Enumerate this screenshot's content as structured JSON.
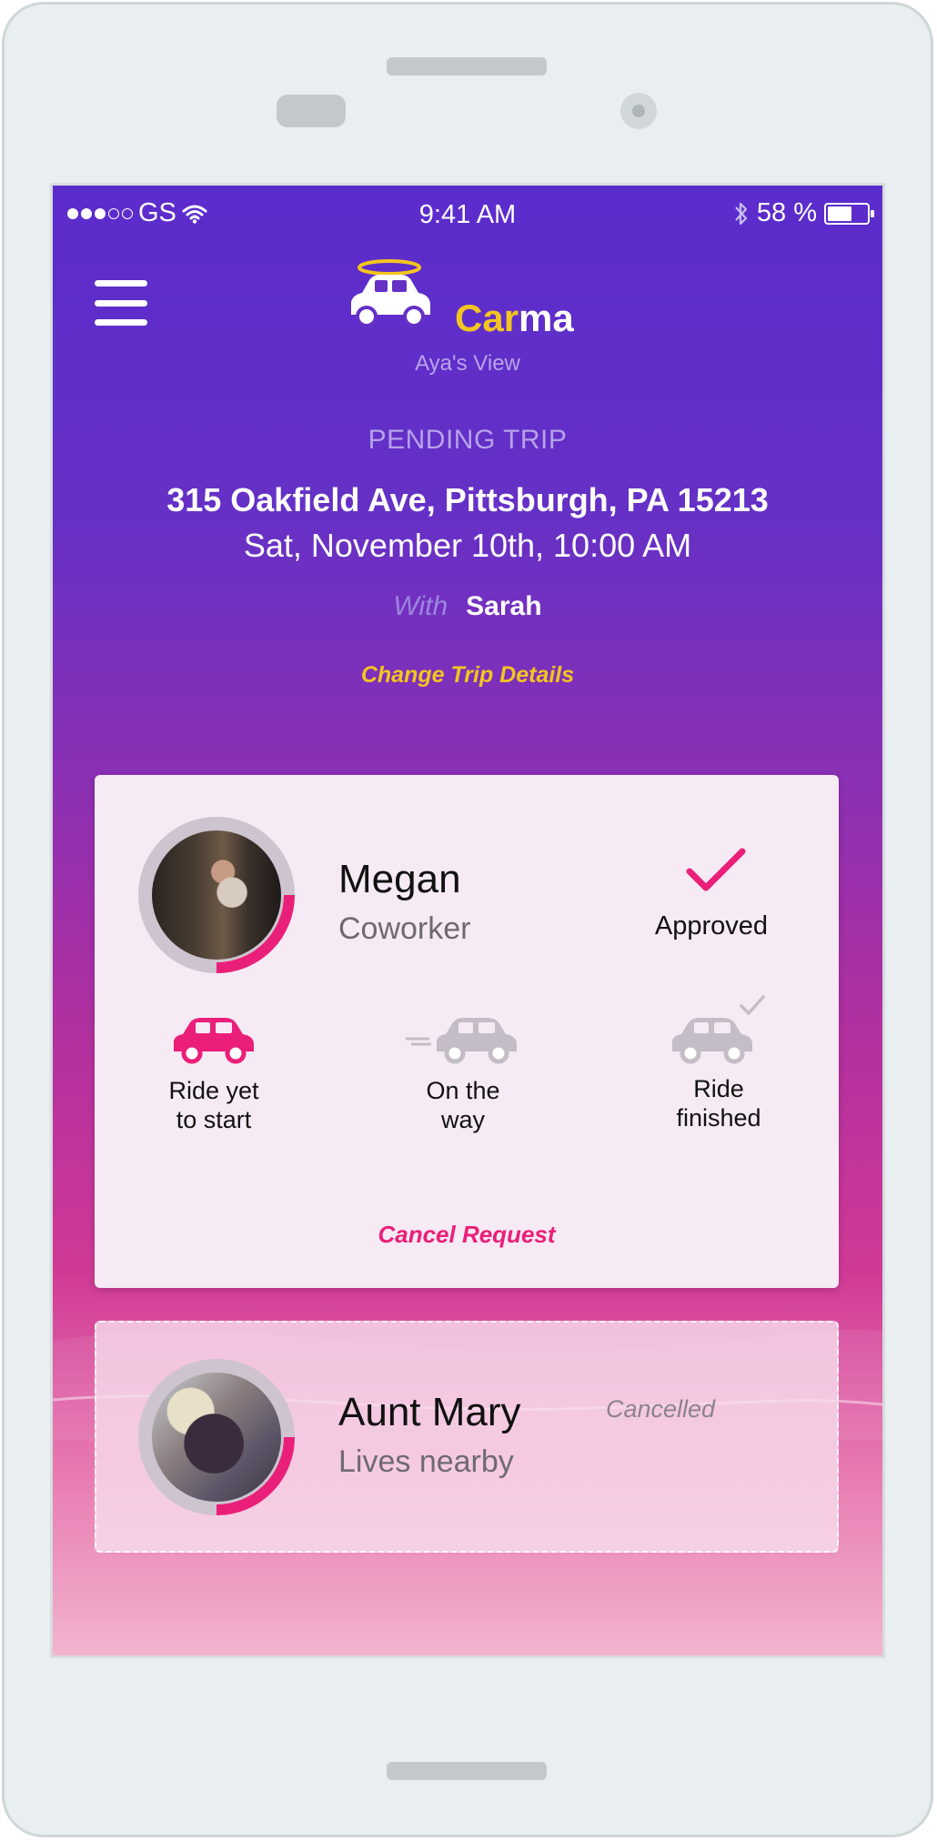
{
  "status_bar": {
    "carrier": "GS",
    "time": "9:41 AM",
    "battery": "58 %",
    "icons": [
      "signal-dots",
      "wifi-icon",
      "bluetooth-icon",
      "battery-icon"
    ]
  },
  "header": {
    "brand_car": "Car",
    "brand_ma": "ma",
    "subtitle": "Aya's View"
  },
  "trip": {
    "status": "PENDING TRIP",
    "address": "315 Oakfield Ave, Pittsburgh, PA 15213",
    "datetime": "Sat, November 10th, 10:00 AM",
    "with_label": "With",
    "with_name": "Sarah",
    "change_link": "Change Trip Details"
  },
  "riders": [
    {
      "name": "Megan",
      "role": "Coworker",
      "status": "Approved",
      "steps": [
        {
          "label": "Ride yet to start",
          "icon": "car-icon",
          "active": true
        },
        {
          "label": "On the way",
          "icon": "car-moving-icon",
          "active": false
        },
        {
          "label": "Ride finished",
          "icon": "car-check-icon",
          "active": false
        }
      ],
      "cancel_link": "Cancel Request"
    },
    {
      "name": "Aunt Mary",
      "role": "Lives nearby",
      "status": "Cancelled"
    }
  ],
  "colors": {
    "accent_yellow": "#f3c51f",
    "accent_pink": "#ea1f79",
    "gradient_top": "#5b2ccc",
    "gradient_bottom": "#f2b4cf"
  }
}
